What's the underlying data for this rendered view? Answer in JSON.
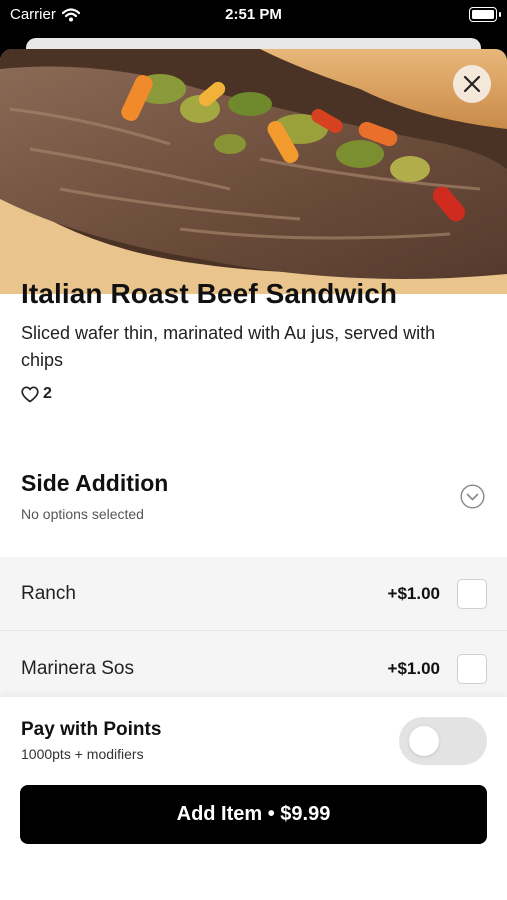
{
  "status_bar": {
    "carrier": "Carrier",
    "time": "2:51 PM"
  },
  "item": {
    "title": "Italian Roast Beef Sandwich",
    "description": "Sliced wafer thin, marinated with Au jus, served with chips",
    "likes": "2"
  },
  "section": {
    "title": "Side Addition",
    "subtitle": "No options selected"
  },
  "options": [
    {
      "label": "Ranch",
      "price": "+$1.00",
      "checked": false
    },
    {
      "label": "Marinera Sos",
      "price": "+$1.00",
      "checked": false
    }
  ],
  "points": {
    "title": "Pay with Points",
    "subtitle": "1000pts + modifiers",
    "enabled": false
  },
  "cta": {
    "label": "Add Item • $9.99"
  },
  "icons": {
    "wifi": "wifi-icon",
    "battery": "battery-icon",
    "close": "close-icon",
    "heart": "heart-icon",
    "chevron": "chevron-down-icon"
  },
  "colors": {
    "primary": "#000000",
    "accent_peppers": "#e0552a"
  }
}
